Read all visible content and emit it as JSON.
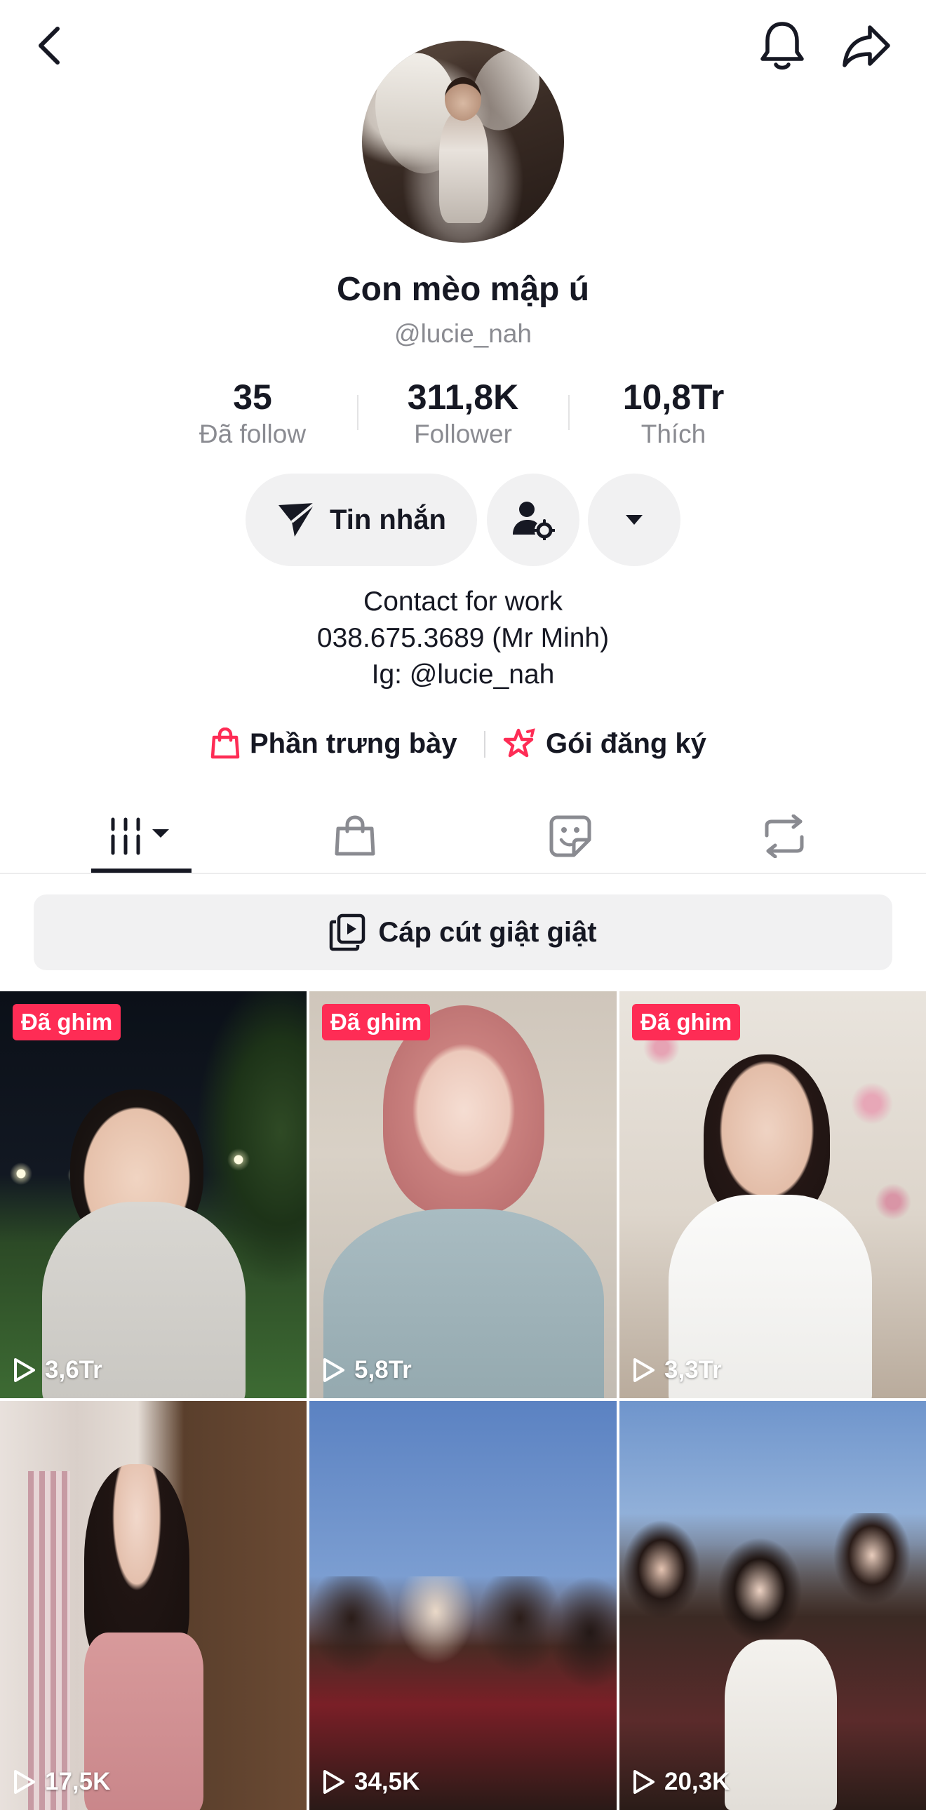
{
  "header": {
    "back_icon": "chevron-left-icon",
    "bell_icon": "bell-icon",
    "share_icon": "share-arrow-icon"
  },
  "profile": {
    "display_name": "Con mèo mập ú",
    "username": "@lucie_nah",
    "stats": [
      {
        "value": "35",
        "label": "Đã follow"
      },
      {
        "value": "311,8K",
        "label": "Follower"
      },
      {
        "value": "10,8Tr",
        "label": "Thích"
      }
    ]
  },
  "actions": {
    "message_label": "Tin nhắn",
    "message_icon": "send-icon",
    "settings_icon": "user-settings-icon",
    "more_icon": "caret-down-icon"
  },
  "bio": {
    "lines": [
      "Contact for work",
      "038.675.3689 (Mr Minh)",
      "Ig: @lucie_nah"
    ]
  },
  "links": {
    "showcase_label": "Phần trưng bày",
    "subscription_label": "Gói đăng ký",
    "accent_color": "#fe2c55"
  },
  "tabs": {
    "items": [
      "videos-grid-icon",
      "shopping-bag-icon",
      "sticker-face-icon",
      "repost-icon"
    ],
    "active_index": 0
  },
  "playlist": {
    "label": "Cáp cút giật giật",
    "icon": "playlist-icon"
  },
  "videos": [
    {
      "pinned": true,
      "pin_label": "Đã ghim",
      "views": "3,6Tr"
    },
    {
      "pinned": true,
      "pin_label": "Đã ghim",
      "views": "5,8Tr"
    },
    {
      "pinned": true,
      "pin_label": "Đã ghim",
      "views": "3,3Tr"
    },
    {
      "pinned": false,
      "views": "17,5K"
    },
    {
      "pinned": false,
      "views": "34,5K"
    },
    {
      "pinned": false,
      "views": "20,3K"
    }
  ]
}
